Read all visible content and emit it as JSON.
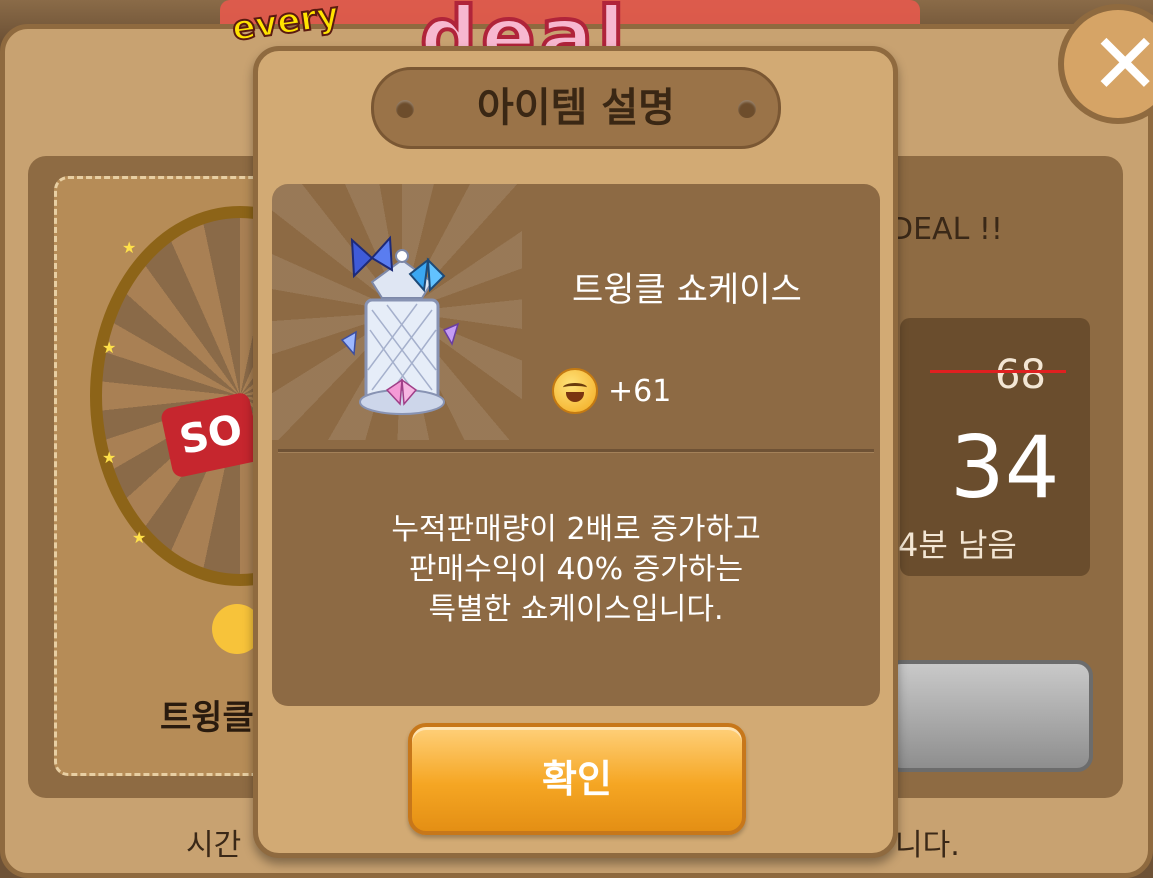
{
  "banner": {
    "every_label": "every",
    "title": "deal"
  },
  "background": {
    "deal_text": "DEAL !!",
    "old_price": "68",
    "new_price": "34",
    "remaining": "4분 남음",
    "item_name_partial": "트윙클",
    "sale_tag": "SO",
    "footer_left": "시간",
    "footer_right": "니다."
  },
  "modal": {
    "title": "아이템 설명",
    "item_name": "트윙클 쇼케이스",
    "bonus_value": "+61",
    "description": [
      "누적판매량이 2배로 증가하고",
      "판매수익이 40% 증가하는",
      "특별한 쇼케이스입니다."
    ],
    "confirm_label": "확인"
  },
  "icons": {
    "close": "close-icon",
    "coin": "smile-coin-icon",
    "item": "showcase-item-icon"
  },
  "colors": {
    "accent": "#f5a623",
    "panel": "#d2aa74",
    "content": "#8d6a44",
    "strike": "#e02020"
  }
}
